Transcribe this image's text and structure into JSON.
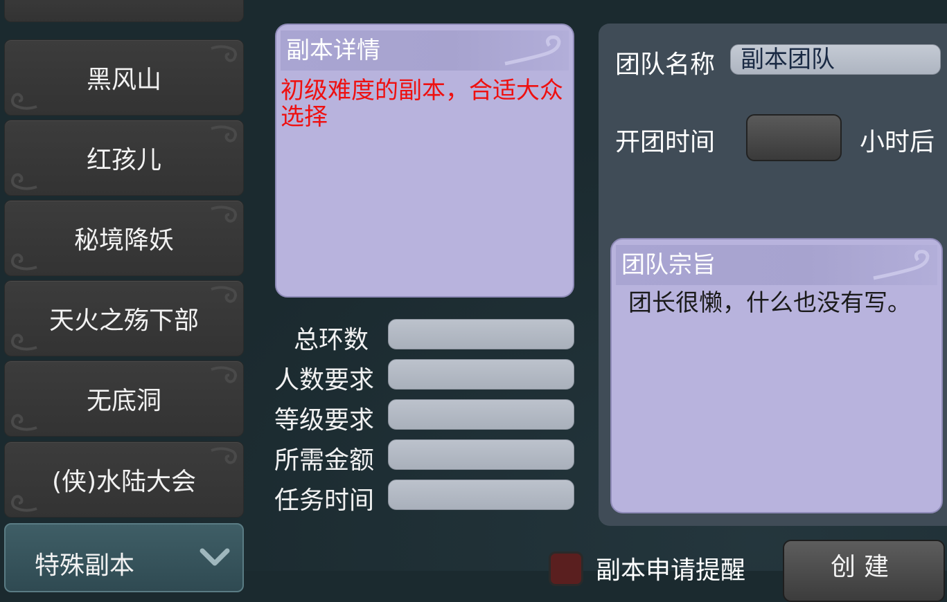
{
  "instance_list": {
    "items": [
      {
        "label": ""
      },
      {
        "label": "黑风山"
      },
      {
        "label": "红孩儿"
      },
      {
        "label": "秘境降妖"
      },
      {
        "label": "天火之殇下部"
      },
      {
        "label": "无底洞"
      },
      {
        "label": "(侠)水陆大会"
      }
    ],
    "category_dropdown": {
      "label": "特殊副本",
      "icon": "chevron-down-icon"
    }
  },
  "detail": {
    "title": "副本详情",
    "description": "初级难度的副本，合适大众选择"
  },
  "stats": {
    "total_rounds_label": "总环数",
    "player_count_label": "人数要求",
    "level_label": "等级要求",
    "gold_label": "所需金额",
    "task_time_label": "任务时间"
  },
  "team": {
    "name_label": "团队名称",
    "name_value": "副本团队",
    "start_time_label": "开团时间",
    "hours_suffix": "小时后",
    "motto_title": "团队宗旨",
    "motto_text": "团长很懒，什么也没有写。"
  },
  "footer": {
    "remind_label": "副本申请提醒",
    "create_button": "创建"
  },
  "colors": {
    "panel_purple": "#b8b3dd",
    "description_red": "#ee1010",
    "dark_panel": "#404c57"
  }
}
